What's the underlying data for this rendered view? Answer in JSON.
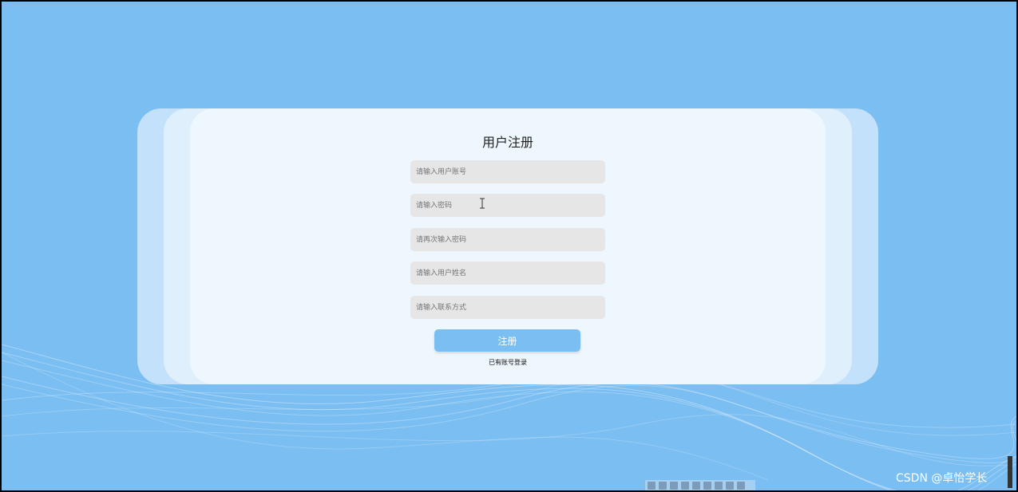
{
  "register": {
    "title": "用户注册",
    "fields": {
      "account": {
        "placeholder": "请输入用户账号",
        "value": ""
      },
      "password": {
        "placeholder": "请输入密码",
        "value": ""
      },
      "confirm_password": {
        "placeholder": "请再次输入密码",
        "value": ""
      },
      "name": {
        "placeholder": "请输入用户姓名",
        "value": ""
      },
      "contact": {
        "placeholder": "请输入联系方式",
        "value": ""
      }
    },
    "submit_label": "注册",
    "login_link": "已有账号登录"
  },
  "watermark": "CSDN @卓怡学长",
  "colors": {
    "background": "#7bbef2",
    "card": "#eef7fd",
    "field": "#e6e6e6",
    "button": "#7bbef2"
  },
  "icons": [
    "text-cursor-icon"
  ]
}
